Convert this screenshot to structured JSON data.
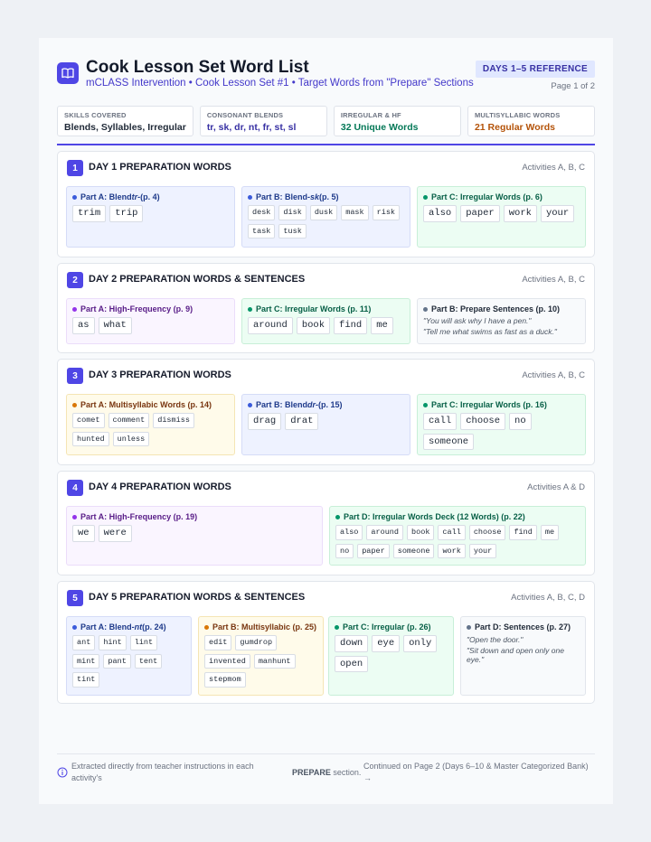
{
  "header": {
    "title": "Cook Lesson Set Word List",
    "subtitle": "mCLASS Intervention • Cook Lesson Set #1 • Target Words from \"Prepare\" Sections",
    "badge": "DAYS 1–5 REFERENCE",
    "page": "Page 1 of 2"
  },
  "skills": [
    {
      "label": "SKILLS COVERED",
      "value": "Blends, Syllables, Irregular",
      "color": "#1f2937"
    },
    {
      "label": "CONSONANT BLENDS",
      "value": "tr, sk, dr, nt, fr, st, sl",
      "color": "#3730a3"
    },
    {
      "label": "IRREGULAR & HF",
      "value": "32 Unique Words",
      "color": "#047857"
    },
    {
      "label": "MULTISYLLABIC WORDS",
      "value": "21 Regular Words",
      "color": "#b45309"
    }
  ],
  "days": [
    {
      "num": "1",
      "title": "DAY 1 PREPARATION WORDS",
      "activities": "Activities A, B, C",
      "parts": [
        {
          "pre": "Part A: Blend ",
          "em": "tr-",
          "post": " (p. 4)",
          "words": [
            "trim",
            "trip"
          ]
        },
        {
          "pre": "Part B: Blend ",
          "em": "-sk",
          "post": " (p. 5)",
          "words": [
            "desk",
            "disk",
            "dusk",
            "mask",
            "risk",
            "task",
            "tusk"
          ]
        },
        {
          "pre": "Part C: Irregular Words (p. 6)",
          "em": "",
          "post": "",
          "words": [
            "also",
            "paper",
            "work",
            "your"
          ]
        }
      ]
    },
    {
      "num": "2",
      "title": "DAY 2 PREPARATION WORDS & SENTENCES",
      "activities": "Activities A, B, C",
      "parts": [
        {
          "pre": "Part A: High-Frequency (p. 9)",
          "em": "",
          "post": "",
          "words": [
            "as",
            "what"
          ]
        },
        {
          "pre": "Part C: Irregular Words (p. 11)",
          "em": "",
          "post": "",
          "words": [
            "around",
            "book",
            "find",
            "me"
          ]
        },
        {
          "pre": "Part B: Prepare Sentences (p. 10)",
          "em": "",
          "post": "",
          "sentences": [
            "\"You will ask why I have a pen.\"",
            "\"Tell me what swims as fast as a duck.\""
          ]
        }
      ]
    },
    {
      "num": "3",
      "title": "DAY 3 PREPARATION WORDS",
      "activities": "Activities A, B, C",
      "parts": [
        {
          "pre": "Part A: Multisyllabic Words (p. 14)",
          "em": "",
          "post": "",
          "words": [
            "comet",
            "comment",
            "dismiss",
            "hunted",
            "unless"
          ]
        },
        {
          "pre": "Part B: Blend ",
          "em": "dr-",
          "post": " (p. 15)",
          "words": [
            "drag",
            "drat"
          ]
        },
        {
          "pre": "Part C: Irregular Words (p. 16)",
          "em": "",
          "post": "",
          "words": [
            "call",
            "choose",
            "no",
            "someone"
          ]
        }
      ]
    },
    {
      "num": "4",
      "title": "DAY 4 PREPARATION WORDS",
      "activities": "Activities A & D",
      "parts": [
        {
          "pre": "Part A: High-Frequency (p. 19)",
          "em": "",
          "post": "",
          "words": [
            "we",
            "were"
          ]
        },
        {
          "pre": "Part D: Irregular Words Deck (12 Words) (p. 22)",
          "em": "",
          "post": "",
          "words": [
            "also",
            "around",
            "book",
            "call",
            "choose",
            "find",
            "me",
            "no",
            "paper",
            "someone",
            "work",
            "your"
          ]
        }
      ]
    },
    {
      "num": "5",
      "title": "DAY 5 PREPARATION WORDS & SENTENCES",
      "activities": "Activities A, B, C, D",
      "parts": [
        {
          "pre": "Part A: Blend ",
          "em": "-nt",
          "post": " (p. 24)",
          "words": [
            "ant",
            "hint",
            "lint",
            "mint",
            "pant",
            "tent",
            "tint"
          ]
        },
        {
          "pre": "Part B: Multisyllabic (p. 25)",
          "em": "",
          "post": "",
          "words": [
            "edit",
            "gumdrop",
            "invented",
            "manhunt",
            "stepmom"
          ]
        },
        {
          "pre": "Part C: Irregular (p. 26)",
          "em": "",
          "post": "",
          "words": [
            "down",
            "eye",
            "only",
            "open"
          ]
        },
        {
          "pre": "Part D: Sentences (p. 27)",
          "em": "",
          "post": "",
          "sentences": [
            "\"Open the door.\"",
            "\"Sit down and open only one eye.\""
          ]
        }
      ]
    }
  ],
  "footer": {
    "note": "Extracted directly from teacher instructions in each activity's",
    "keyword": "PREPARE",
    "keyword_suffix": " section.",
    "continued": "Continued on Page 2 (Days 6–10 & Master Categorized Bank) →"
  }
}
